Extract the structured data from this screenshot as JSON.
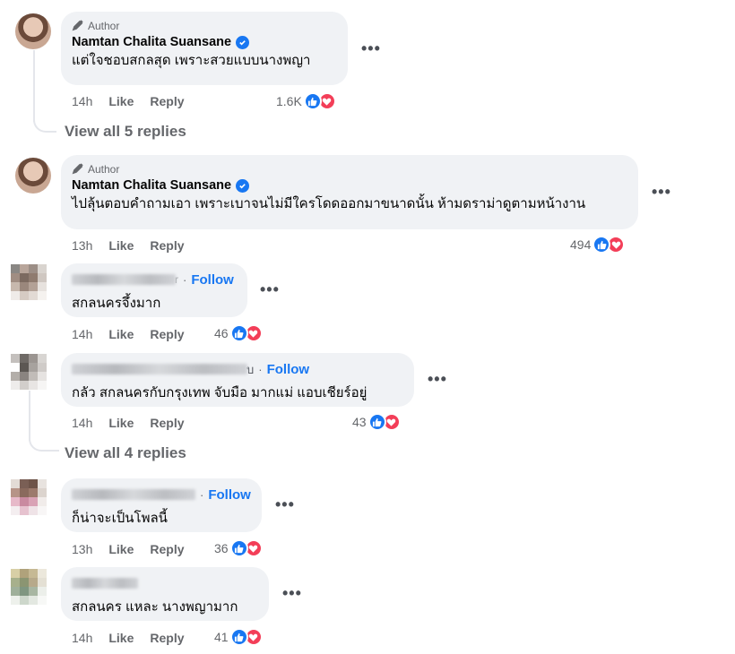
{
  "comments": [
    {
      "author_tag": "Author",
      "name": "Namtan Chalita Suansane",
      "text": "แต่ใจชอบสกลสุด เพราะสวยแบบนางพญา",
      "time": "14h",
      "like_label": "Like",
      "reply_label": "Reply",
      "reactions": "1.6K",
      "view_replies": "View all 5 replies"
    },
    {
      "author_tag": "Author",
      "name": "Namtan Chalita Suansane",
      "text": "ไปลุ้นตอบคำถามเอา เพราะเบาจนไม่มีใครโดดออกมาขนาดนั้น ห้ามดราม่าดูตามหน้างาน",
      "time": "13h",
      "like_label": "Like",
      "reply_label": "Reply",
      "reactions": "494"
    },
    {
      "name_suffix": "r",
      "follow": "Follow",
      "text": "สกลนครจึ้งมาก",
      "time": "14h",
      "like_label": "Like",
      "reply_label": "Reply",
      "reactions": "46"
    },
    {
      "name_suffix": "บ",
      "follow": "Follow",
      "text": "กลัว สกลนครกับกรุงเทพ จับมือ มากแม่ แอบเชียร์อยู่",
      "time": "14h",
      "like_label": "Like",
      "reply_label": "Reply",
      "reactions": "43",
      "view_replies": "View all 4 replies"
    },
    {
      "follow": "Follow",
      "text": "ก็น่าจะเป็นโพลนี้",
      "time": "13h",
      "like_label": "Like",
      "reply_label": "Reply",
      "reactions": "36"
    },
    {
      "text": "สกลนคร แหละ นางพญามาก",
      "time": "14h",
      "like_label": "Like",
      "reply_label": "Reply",
      "reactions": "41"
    }
  ],
  "more_label": "•••",
  "colors": {
    "accent": "#1877f2",
    "love": "#f33e58",
    "bubble": "#f0f2f5",
    "muted": "#65676b"
  }
}
